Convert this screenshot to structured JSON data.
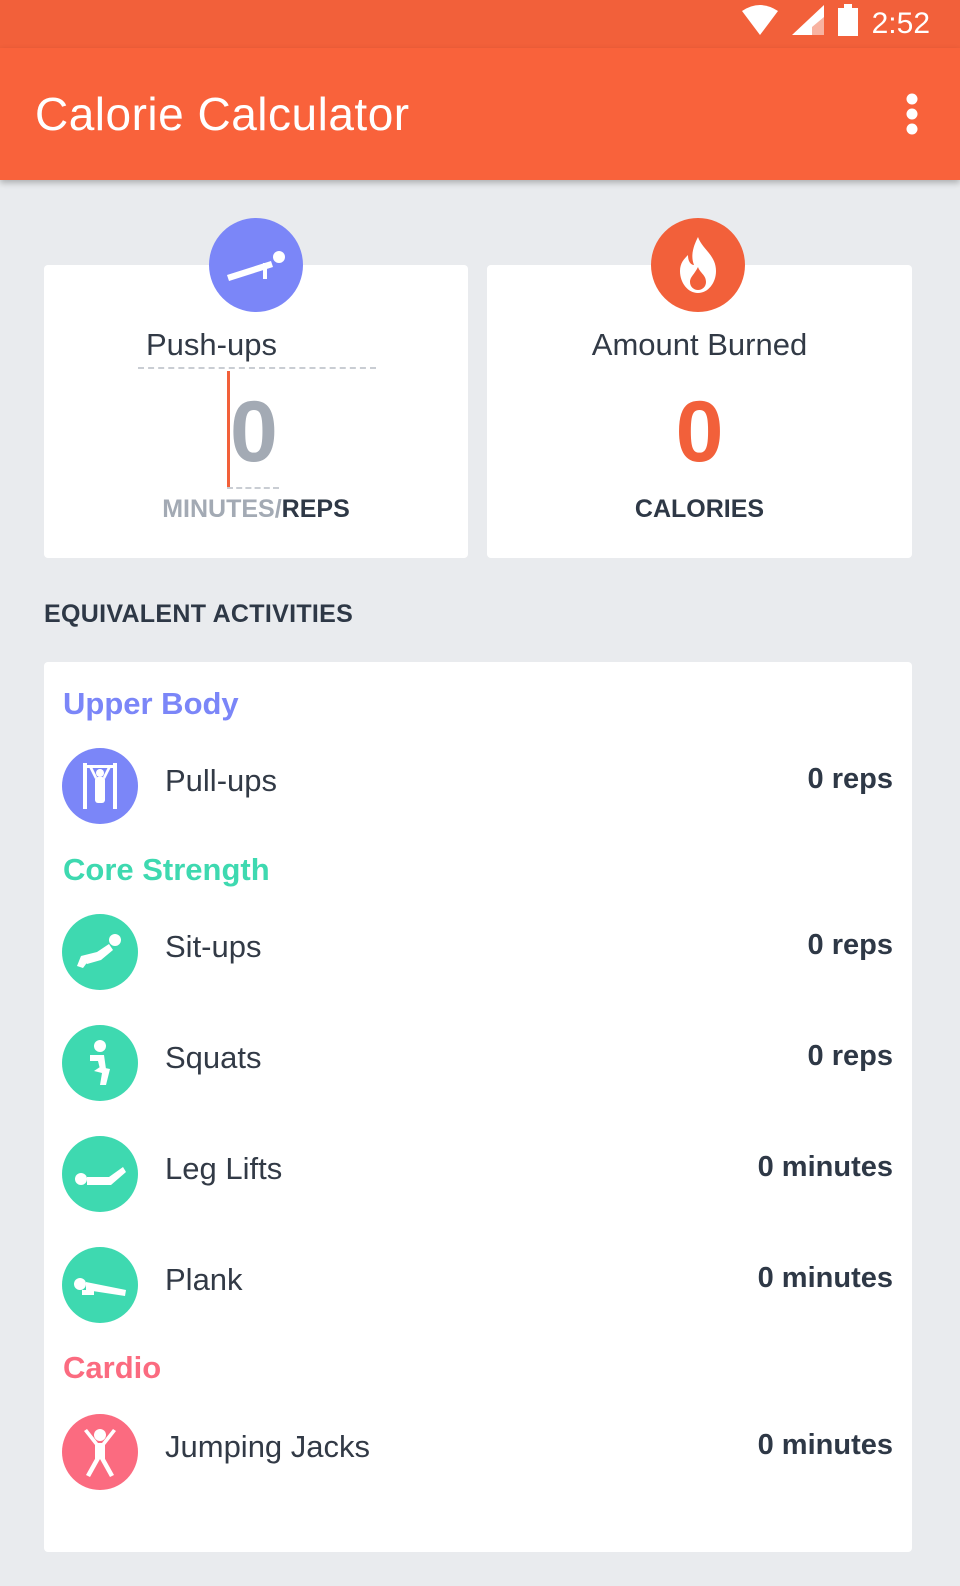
{
  "status_bar": {
    "time": "2:52",
    "icons": [
      "wifi-icon",
      "cell-signal-icon",
      "battery-icon"
    ]
  },
  "app_bar": {
    "title": "Calorie Calculator",
    "menu_icon": "more-vert-icon"
  },
  "input_card": {
    "icon": "pushup-icon",
    "exercise": "Push-ups",
    "value": "0",
    "unit_minutes": "MINUTES/",
    "unit_reps": "REPS"
  },
  "burned_card": {
    "icon": "flame-icon",
    "label": "Amount Burned",
    "value": "0",
    "unit": "CALORIES"
  },
  "section_title": "EQUIVALENT ACTIVITIES",
  "groups": [
    {
      "title": "Upper Body",
      "color": "#7b86f8",
      "items": [
        {
          "name": "Pull-ups",
          "value": "0 reps",
          "icon": "pullup-icon"
        }
      ]
    },
    {
      "title": "Core Strength",
      "color": "#3ed9b0",
      "items": [
        {
          "name": "Sit-ups",
          "value": "0 reps",
          "icon": "situp-icon"
        },
        {
          "name": "Squats",
          "value": "0 reps",
          "icon": "squat-icon"
        },
        {
          "name": "Leg Lifts",
          "value": "0 minutes",
          "icon": "leg-lift-icon"
        },
        {
          "name": "Plank",
          "value": "0 minutes",
          "icon": "plank-icon"
        }
      ]
    },
    {
      "title": "Cardio",
      "color": "#fb6b80",
      "items": [
        {
          "name": "Jumping Jacks",
          "value": "0 minutes",
          "icon": "jumping-jack-icon"
        }
      ]
    }
  ],
  "colors": {
    "accent": "#f9623b",
    "background": "#e9ebee",
    "text": "#2e3846"
  }
}
